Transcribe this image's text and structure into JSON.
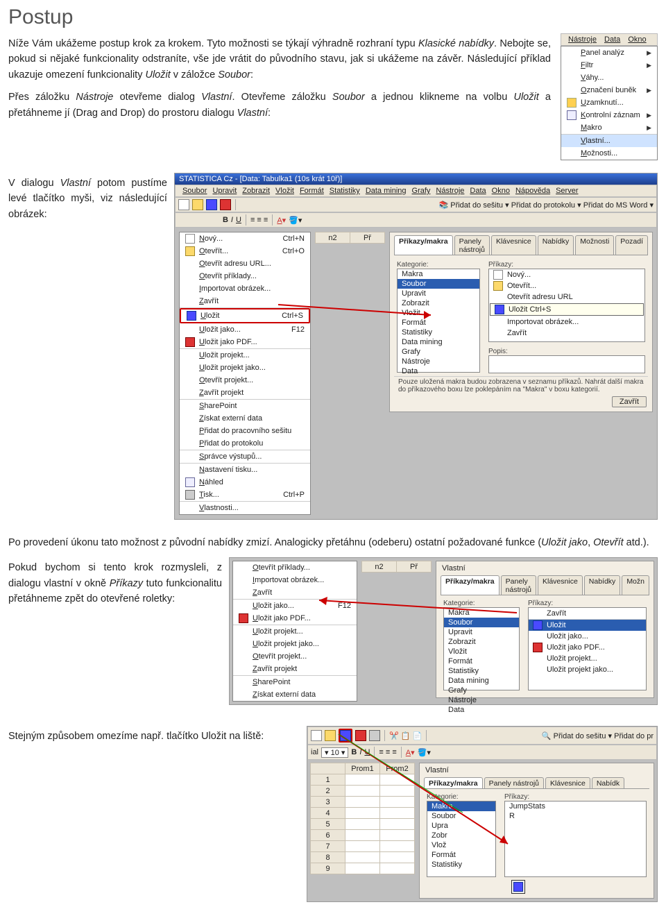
{
  "title": "Postup",
  "para1_a": "Níže Vám ukážeme postup krok za krokem. Tyto možnosti se týkají výhradně rozhraní typu ",
  "para1_b": "Klasické nabídky",
  "para1_c": ". Nebojte se, pokud si nějaké funkcionality odstraníte, vše jde vrátit do původního stavu, jak si ukážeme na závěr. Následující příklad ukazuje omezení funkcionality ",
  "para1_d": "Uložit",
  "para1_e": " v záložce ",
  "para1_f": "Soubor",
  "para2_a": "Přes záložku ",
  "para2_b": "Nástroje",
  "para2_c": " otevřeme dialog ",
  "para2_d": "Vlastní",
  "para2_e": ". Otevřeme záložku ",
  "para2_f": "Soubor",
  "para2_g": " a jednou klikneme na volbu ",
  "para2_h": "Uložit",
  "para2_i": " a přetáhneme jí (Drag and Drop) do prostoru dialogu ",
  "para2_j": "Vlastní",
  "para3_a": "V dialogu ",
  "para3_b": "Vlastní",
  "para3_c": " potom pustíme levé tlačítko myši, viz následující obrázek:",
  "para4_a": "Po provedení úkonu tato možnost z původní nabídky zmizí. Analogicky přetáhnu (odeberu) ostatní požadované funkce (",
  "para4_b": "Uložit jako",
  "para4_c": ", ",
  "para4_d": "Otevřít",
  "para4_e": " atd.).",
  "para5_a": "Pokud bychom si tento krok rozmysleli, z dialogu vlastní v okně ",
  "para5_b": "Příkazy",
  "para5_c": " tuto funkcionalitu přetáhneme zpět do otevřené roletky:",
  "para6": "Stejným způsobem omezíme např. tlačítko Uložit na liště:",
  "nastroje_menu": {
    "title": "Nástroje",
    "title2": "Data",
    "title3": "Okno",
    "items": [
      {
        "label": "Panel analýz",
        "arrow": true
      },
      {
        "label": "Filtr",
        "arrow": true
      },
      {
        "label": "Váhy..."
      },
      {
        "label": "Označení buněk",
        "arrow": true
      },
      {
        "label": "Uzamknutí...",
        "icon": "mi-yellow"
      },
      {
        "label": "Kontrolní záznam",
        "arrow": true,
        "icon": "mi-search"
      },
      {
        "label": "Makro",
        "arrow": true,
        "sep": true
      },
      {
        "label": "Vlastní...",
        "hl": true
      },
      {
        "label": "Možnosti..."
      }
    ]
  },
  "soubor_menu": {
    "items": [
      {
        "label": "Nový...",
        "shortcut": "Ctrl+N",
        "icon": "mi-doc"
      },
      {
        "label": "Otevřít...",
        "shortcut": "Ctrl+O",
        "icon": "mi-folder"
      },
      {
        "label": "Otevřít adresu URL..."
      },
      {
        "label": "Otevřít příklady..."
      },
      {
        "label": "Importovat obrázek..."
      },
      {
        "label": "Zavřít",
        "sep": true
      },
      {
        "label": "Uložit",
        "shortcut": "Ctrl+S",
        "icon": "mi-disk",
        "red": true
      },
      {
        "label": "Uložit jako...",
        "shortcut": "F12"
      },
      {
        "label": "Uložit jako PDF...",
        "icon": "mi-pdf",
        "sep": true
      },
      {
        "label": "Uložit projekt..."
      },
      {
        "label": "Uložit projekt jako..."
      },
      {
        "label": "Otevřít projekt..."
      },
      {
        "label": "Zavřít projekt",
        "sep": true
      },
      {
        "label": "SharePoint"
      },
      {
        "label": "Získat externí data"
      },
      {
        "label": "Přidat do pracovního sešitu"
      },
      {
        "label": "Přidat do protokolu",
        "sep": true
      },
      {
        "label": "Správce výstupů...",
        "sep": true
      },
      {
        "label": "Nastavení tisku..."
      },
      {
        "label": "Náhled",
        "icon": "mi-search"
      },
      {
        "label": "Tisk...",
        "shortcut": "Ctrl+P",
        "icon": "mi-print",
        "sep": true
      },
      {
        "label": "Vlastnosti..."
      }
    ]
  },
  "soubor_menu2": {
    "items": [
      {
        "label": "Otevřít příklady..."
      },
      {
        "label": "Importovat obrázek..."
      },
      {
        "label": "Zavřít",
        "sep": true
      },
      {
        "label": "Uložit jako...",
        "shortcut": "F12"
      },
      {
        "label": "Uložit jako PDF...",
        "icon": "mi-pdf",
        "sep": true
      },
      {
        "label": "Uložit projekt..."
      },
      {
        "label": "Uložit projekt jako..."
      },
      {
        "label": "Otevřít projekt..."
      },
      {
        "label": "Zavřít projekt",
        "sep": true
      },
      {
        "label": "SharePoint"
      },
      {
        "label": "Získat externí data"
      }
    ]
  },
  "statistica_title": "STATISTICA Cz - [Data: Tabulka1 (10s krát 10ř)]",
  "main_menus": [
    "Soubor",
    "Upravit",
    "Zobrazit",
    "Vložit",
    "Formát",
    "Statistiky",
    "Data mining",
    "Grafy",
    "Nástroje",
    "Data",
    "Okno",
    "Nápověda",
    "Server"
  ],
  "toolbar_right": [
    "Přidat do sešitu",
    "Přidat do protokolu",
    "Přidat do MS Word"
  ],
  "vlastni_title": "Vlastní",
  "tabs": [
    "Příkazy/makra",
    "Panely nástrojů",
    "Klávesnice",
    "Nabídky",
    "Možnosti",
    "Pozadí"
  ],
  "tabs_short": [
    "Příkazy/makra",
    "Panely nástrojů",
    "Klávesnice",
    "Nabídky",
    "Možn"
  ],
  "tabs_very_short": [
    "Příkazy/makra",
    "Panely nástrojů",
    "Klávesnice",
    "Nabídk"
  ],
  "kategorie_label": "Kategorie:",
  "prikazy_label": "Příkazy:",
  "popis_label": "Popis:",
  "help_text": "Pouze uložená makra budou zobrazena v seznamu příkazů. Nahrát další makra do příkazového boxu lze poklepáním na \"Makra\" v boxu kategorií.",
  "btn_zavrit": "Zavřít",
  "kategorie_items": [
    "Makra",
    "Soubor",
    "Upravit",
    "Zobrazit",
    "Vložit",
    "Formát",
    "Statistiky",
    "Data mining",
    "Grafy",
    "Nástroje",
    "Data"
  ],
  "prikazy_items1": [
    {
      "label": "Nový...",
      "icon": "mi-doc"
    },
    {
      "label": "Otevřít...",
      "icon": "mi-folder"
    },
    {
      "label": "Otevřít adresu URL"
    },
    {
      "label": "Uložit   Ctrl+S",
      "icon": "mi-disk",
      "box": true
    },
    {
      "label": "Importovat obrázek..."
    },
    {
      "label": "Zavřít"
    }
  ],
  "prikazy_items2": [
    {
      "label": "Zavřít",
      "sep": true
    },
    {
      "label": "Uložit",
      "icon": "mi-disk",
      "hl": true
    },
    {
      "label": "Uložit jako..."
    },
    {
      "label": "Uložit jako PDF...",
      "icon": "mi-pdf"
    },
    {
      "label": "Uložit projekt..."
    },
    {
      "label": "Uložit projekt jako..."
    }
  ],
  "kategorie_items3": [
    "Makra",
    "Soubor",
    "Upra",
    "Zobr",
    "Vlož",
    "Formát",
    "Statistiky"
  ],
  "prikazy_items3": [
    {
      "label": "JumpStats"
    },
    {
      "label": "R"
    }
  ],
  "tb2_cols": [
    "Prom1",
    "Prom2"
  ],
  "tb2_rows": [
    "1",
    "2",
    "3",
    "4",
    "5",
    "6",
    "7",
    "8",
    "9"
  ],
  "font_size": "10",
  "pridat_pro": "Přidat do sešitu",
  "pridat_p2": "Přidat do pr",
  "n2_col": "n2",
  "Pr_col": "Př"
}
